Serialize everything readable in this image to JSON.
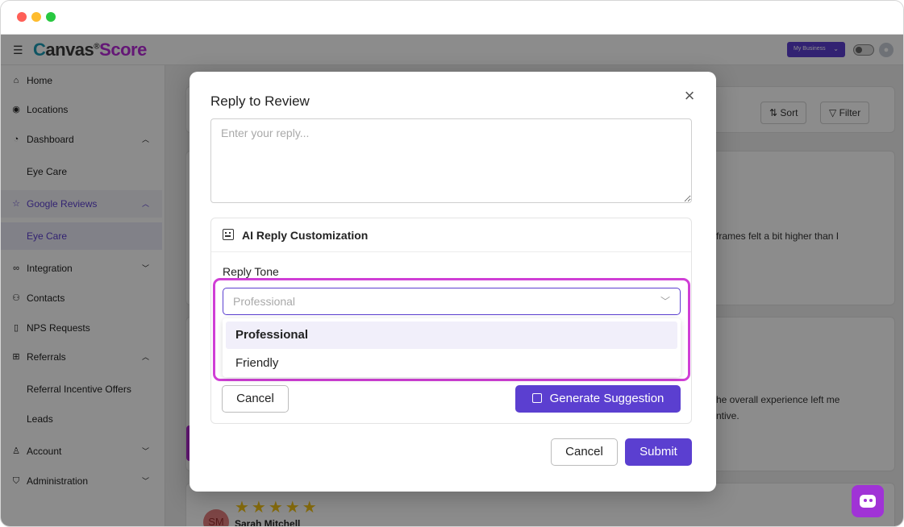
{
  "app": {
    "logo": {
      "part1": "C",
      "part2": "anvas",
      "mark": "®",
      "part3": "Score"
    },
    "business_selector": "My Business"
  },
  "sidebar": {
    "items": [
      {
        "label": "Home",
        "icon": "home-icon"
      },
      {
        "label": "Locations",
        "icon": "location-pin-icon"
      },
      {
        "label": "Dashboard",
        "icon": "pie-chart-icon"
      },
      {
        "label": "Eye Care"
      },
      {
        "label": "Google Reviews",
        "icon": "star-icon"
      },
      {
        "label": "Eye Care"
      },
      {
        "label": "Integration",
        "icon": "link-icon"
      },
      {
        "label": "Contacts",
        "icon": "contacts-icon"
      },
      {
        "label": "NPS Requests",
        "icon": "document-icon"
      },
      {
        "label": "Referrals",
        "icon": "gift-icon"
      },
      {
        "label": "Referral Incentive Offers"
      },
      {
        "label": "Leads"
      },
      {
        "label": "Account",
        "icon": "user-icon"
      },
      {
        "label": "Administration",
        "icon": "shield-icon"
      }
    ]
  },
  "toolbar": {
    "sort": "Sort",
    "filter": "Filter"
  },
  "background_reviews": {
    "snippet1": "frames felt a bit higher than I",
    "snippet2_line1": "he overall experience left me",
    "snippet2_line2": "ntive.",
    "stars": "★★★★★",
    "reviewer_initials": "SM",
    "reviewer_name": "Sarah Mitchell"
  },
  "modal": {
    "title": "Reply to Review",
    "reply_placeholder": "Enter your reply...",
    "ai_section_title": "AI Reply Customization",
    "tone_label": "Reply Tone",
    "tone_select_value": "Professional",
    "tone_options": [
      "Professional",
      "Friendly"
    ],
    "inner_cancel": "Cancel",
    "generate_label": "Generate Suggestion",
    "cancel_label": "Cancel",
    "submit_label": "Submit"
  },
  "colors": {
    "accent": "#5b3fd0",
    "highlight": "#d03fd6",
    "logo_score": "#b72bd8"
  }
}
